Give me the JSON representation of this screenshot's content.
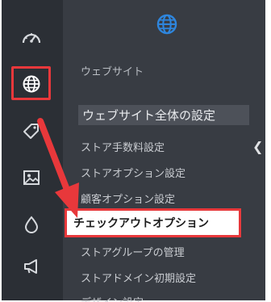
{
  "colors": {
    "rail_bg": "#2b2f35",
    "panel_bg": "#383c43",
    "accent_blue": "#2e86de",
    "highlight_red": "#e8383b"
  },
  "rail": {
    "icons": [
      {
        "name": "dashboard-gauge-icon"
      },
      {
        "name": "globe-icon",
        "active": true
      },
      {
        "name": "tag-icon"
      },
      {
        "name": "image-icon"
      },
      {
        "name": "droplet-icon"
      },
      {
        "name": "megaphone-icon"
      }
    ]
  },
  "panel": {
    "header_icon": "globe-icon",
    "section_label": "ウェブサイト",
    "section_title": "ウェブサイト全体の設定",
    "collapse_icon": "chevron-left-icon",
    "menu": [
      "ストア手数料設定",
      "ストアオプション設定",
      "顧客オプション設定",
      "チェックアウトオプション",
      "ストアグループの管理",
      "ストアドメイン初期設定",
      "デザイン設定"
    ],
    "highlighted_index": 3
  },
  "annotation": {
    "arrow_icon": "red-arrow-icon"
  }
}
